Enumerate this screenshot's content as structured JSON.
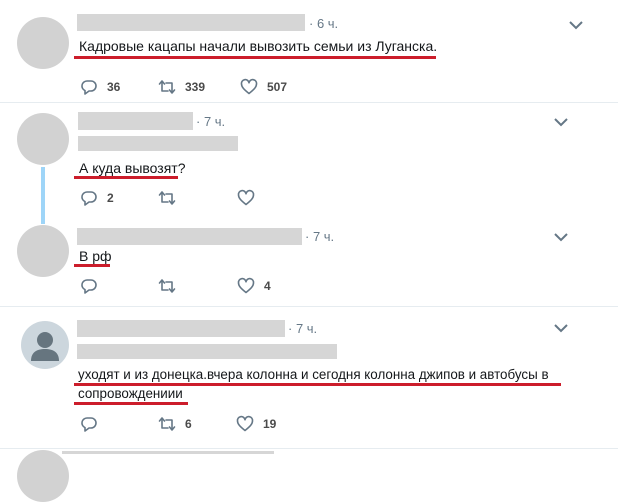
{
  "tweets": [
    {
      "time": "· 6 ч.",
      "text": "Кадровые кацапы начали вывозить семьи из Луганска.",
      "reply_count": "36",
      "retweet_count": "339",
      "like_count": "507"
    },
    {
      "time": "· 7 ч.",
      "text": "А куда вывозят?",
      "reply_count": "2",
      "retweet_count": "",
      "like_count": ""
    },
    {
      "time": "· 7 ч.",
      "text": "В рф",
      "reply_count": "",
      "retweet_count": "",
      "like_count": "4"
    },
    {
      "time": "· 7 ч.",
      "text_line1": "уходят и из донецка.вчера колонна и сегодня колонна джипов и автобусы в",
      "text_line2": "сопровождениии",
      "reply_count": "",
      "retweet_count": "6",
      "like_count": "19"
    }
  ],
  "icons": {
    "reply": "reply-icon",
    "retweet": "retweet-icon",
    "like": "like-icon",
    "more": "chevron-down-icon",
    "avatar": "default-avatar-icon"
  },
  "colors": {
    "underline": "#cc1d2b",
    "thread": "#9ed5f8",
    "icon": "#657786"
  }
}
